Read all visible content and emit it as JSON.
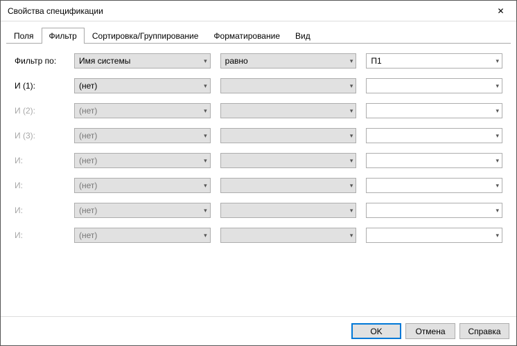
{
  "window": {
    "title": "Свойства спецификации"
  },
  "tabs": {
    "fields": "Поля",
    "filter": "Фильтр",
    "sort": "Сортировка/Группирование",
    "format": "Форматирование",
    "view": "Вид",
    "active": "filter"
  },
  "filter": {
    "mainLabel": "Фильтр по:",
    "mainField": "Имя системы",
    "mainOperator": "равно",
    "mainValue": "П1",
    "rows": [
      {
        "label": "И (1):",
        "enabled": true,
        "field": "(нет)",
        "operator": "",
        "value": ""
      },
      {
        "label": "И (2):",
        "enabled": false,
        "field": "(нет)",
        "operator": "",
        "value": ""
      },
      {
        "label": "И (3):",
        "enabled": false,
        "field": "(нет)",
        "operator": "",
        "value": ""
      },
      {
        "label": "И:",
        "enabled": false,
        "field": "(нет)",
        "operator": "",
        "value": ""
      },
      {
        "label": "И:",
        "enabled": false,
        "field": "(нет)",
        "operator": "",
        "value": ""
      },
      {
        "label": "И:",
        "enabled": false,
        "field": "(нет)",
        "operator": "",
        "value": ""
      },
      {
        "label": "И:",
        "enabled": false,
        "field": "(нет)",
        "operator": "",
        "value": ""
      }
    ]
  },
  "buttons": {
    "ok": "OK",
    "cancel": "Отмена",
    "help": "Справка"
  }
}
